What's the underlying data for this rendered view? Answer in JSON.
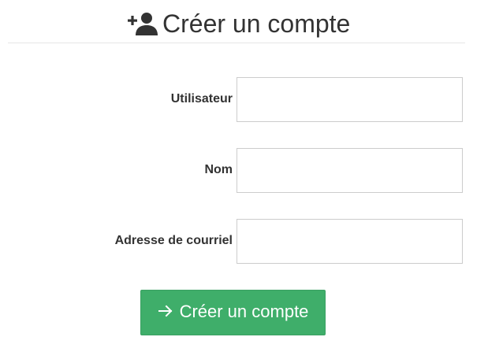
{
  "header": {
    "title": "Créer un compte",
    "icon": "user-plus-icon"
  },
  "form": {
    "fields": [
      {
        "label": "Utilisateur",
        "value": "",
        "placeholder": ""
      },
      {
        "label": "Nom",
        "value": "",
        "placeholder": ""
      },
      {
        "label": "Adresse de courriel",
        "value": "",
        "placeholder": ""
      }
    ],
    "submit": {
      "label": "Créer un compte",
      "icon": "arrow-right-icon",
      "color": "#3fae6a"
    }
  },
  "colors": {
    "text": "#333333",
    "input_border": "#cccccc",
    "divider": "#e6e6e6"
  }
}
